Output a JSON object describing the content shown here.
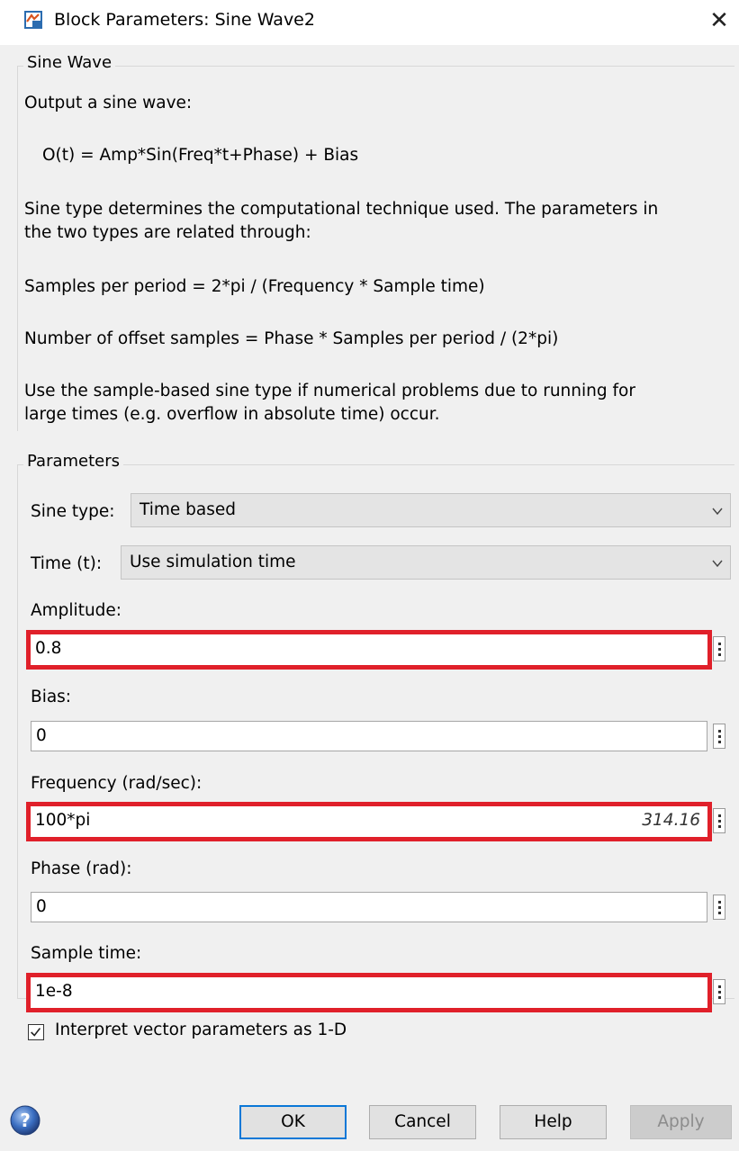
{
  "window": {
    "title": "Block Parameters: Sine Wave2",
    "close_glyph": "✕"
  },
  "description": {
    "legend": "Sine Wave",
    "lines": [
      "Output a sine wave:",
      "O(t) = Amp*Sin(Freq*t+Phase) + Bias",
      "Sine type determines the computational technique used. The parameters in",
      "the two types are related through:",
      "Samples per period = 2*pi / (Frequency * Sample time)",
      "Number of offset samples = Phase * Samples per period / (2*pi)",
      "Use the sample-based sine type if numerical problems due to running for",
      "large times (e.g. overflow in absolute time) occur."
    ]
  },
  "parameters": {
    "legend": "Parameters",
    "sine_type": {
      "label": "Sine type:",
      "value": "Time based"
    },
    "time": {
      "label": "Time (t):",
      "value": "Use simulation time"
    },
    "amplitude": {
      "label": "Amplitude:",
      "value": "0.8",
      "highlighted": true
    },
    "bias": {
      "label": "Bias:",
      "value": "0",
      "highlighted": false
    },
    "frequency": {
      "label": "Frequency (rad/sec):",
      "value": "100*pi",
      "evaluated": "314.16",
      "highlighted": true
    },
    "phase": {
      "label": "Phase (rad):",
      "value": "0",
      "highlighted": false
    },
    "sample_time": {
      "label": "Sample time:",
      "value": "1e-8",
      "highlighted": true
    },
    "interpret_vector": {
      "label": "Interpret vector parameters as 1-D",
      "checked": true
    }
  },
  "buttons": {
    "ok": "OK",
    "cancel": "Cancel",
    "help": "Help",
    "apply": "Apply"
  },
  "colors": {
    "highlight_border": "#e0202a",
    "default_button_border": "#0a78d7"
  },
  "icons": {
    "app": "simulink-block-icon",
    "close": "close-icon",
    "dropdown": "chevron-down-icon",
    "more": "more-options-icon",
    "help": "help-icon"
  }
}
